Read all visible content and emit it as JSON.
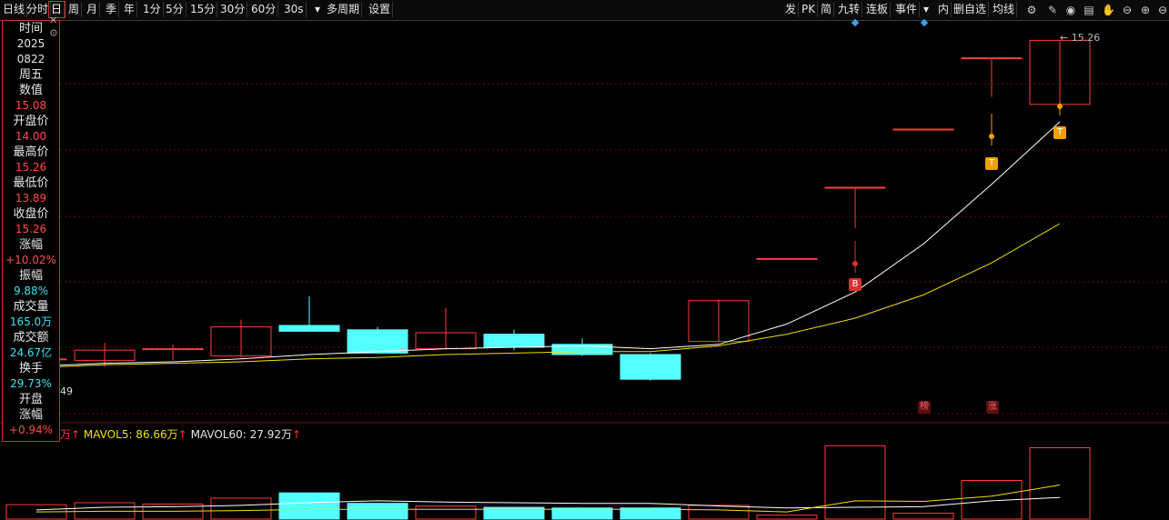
{
  "toolbar": {
    "left_items": [
      "日线",
      "分时",
      "日",
      "周",
      "月",
      "季",
      "年",
      "1分",
      "5分",
      "15分",
      "30分",
      "60分",
      "30s",
      "多周期",
      "设置"
    ],
    "right_items": [
      "发",
      "PK",
      "简",
      "九转",
      "连板",
      "事件",
      "内",
      "删自选",
      "均线"
    ],
    "dropdown_icon": "caret-down-icon"
  },
  "info": {
    "time_label": "时间",
    "year": "2025",
    "date": "0822",
    "weekday": "周五",
    "value_label": "数值",
    "value": "15.08",
    "open_label": "开盘价",
    "open": "14.00",
    "high_label": "最高价",
    "high": "15.26",
    "low_label": "最低价",
    "low": "13.89",
    "close_label": "收盘价",
    "close": "15.26",
    "change_label": "涨幅",
    "change": "+10.02%",
    "amplitude_label": "振幅",
    "amplitude": "9.88%",
    "volume_label": "成交量",
    "volume": "165.0万",
    "turnover_label": "成交额",
    "turnover": "24.67亿",
    "hand_label": "换手",
    "hand": "29.73%",
    "open_gap_label_1": "开盘",
    "open_gap_label_2": "涨幅",
    "open_gap": "+0.94%"
  },
  "price_marker": "15.26",
  "volume_legend": {
    "vol_tail": "万↑",
    "mavol5": "MAVOL5: 86.66万",
    "mavol5_arrow": "↑",
    "mavol60": "MAVOL60: 27.92万",
    "mavol60_arrow": "↑"
  },
  "low_label": "49",
  "flags": {
    "buy": "B",
    "t1": "T",
    "t2": "T",
    "bang": "榜",
    "zhang": "涨"
  },
  "colors": {
    "up": "#ff3b3b",
    "down": "#54ffff",
    "ma_white": "#ffffff",
    "ma_yellow": "#f0e000",
    "grid": "#5a1010",
    "flag_red": "#e03030",
    "flag_orange": "#f0a000"
  },
  "chart_data": {
    "type": "candlestick",
    "price_panel": {
      "candles": [
        {
          "o": 13.07,
          "h": 13.11,
          "l": 12.98,
          "c": 13.07
        },
        {
          "o": 13.06,
          "h": 13.18,
          "l": 13.02,
          "c": 13.13
        },
        {
          "o": 13.14,
          "h": 13.17,
          "l": 13.06,
          "c": 13.14
        },
        {
          "o": 13.09,
          "h": 13.34,
          "l": 13.09,
          "c": 13.29
        },
        {
          "o": 13.3,
          "h": 13.5,
          "l": 13.27,
          "c": 13.26
        },
        {
          "o": 13.27,
          "h": 13.29,
          "l": 13.12,
          "c": 13.11
        },
        {
          "o": 13.14,
          "h": 13.42,
          "l": 13.14,
          "c": 13.25
        },
        {
          "o": 13.24,
          "h": 13.27,
          "l": 13.13,
          "c": 13.15
        },
        {
          "o": 13.17,
          "h": 13.21,
          "l": 13.09,
          "c": 13.1
        },
        {
          "o": 13.1,
          "h": 13.11,
          "l": 12.92,
          "c": 12.93
        },
        {
          "o": 13.19,
          "h": 13.48,
          "l": 13.19,
          "c": 13.47
        },
        {
          "o": 13.76,
          "h": 13.76,
          "l": 13.76,
          "c": 13.76
        },
        {
          "o": 14.25,
          "h": 14.25,
          "l": 13.97,
          "c": 14.25
        },
        {
          "o": 14.65,
          "h": 14.65,
          "l": 14.65,
          "c": 14.65
        },
        {
          "o": 15.14,
          "h": 15.14,
          "l": 14.87,
          "c": 15.14
        },
        {
          "o": 14.82,
          "h": 15.26,
          "l": 14.82,
          "c": 15.26
        }
      ],
      "ma_white": [
        13.02,
        13.04,
        13.05,
        13.07,
        13.1,
        13.12,
        13.14,
        13.15,
        13.16,
        13.14,
        13.17,
        13.31,
        13.53,
        13.86,
        14.27,
        14.7
      ],
      "ma_yellow": [
        13.01,
        13.03,
        13.04,
        13.05,
        13.07,
        13.08,
        13.1,
        13.11,
        13.12,
        13.12,
        13.16,
        13.24,
        13.35,
        13.51,
        13.73,
        14.0
      ],
      "y_range": [
        12.85,
        15.35
      ]
    },
    "volume_panel": {
      "volumes": [
        22,
        25,
        23,
        32,
        40,
        24,
        20,
        18,
        17,
        17,
        21,
        6,
        112,
        9,
        59,
        109
      ],
      "colors": [
        "up",
        "up",
        "up",
        "up",
        "down",
        "down",
        "up",
        "down",
        "down",
        "down",
        "up",
        "up",
        "up",
        "up",
        "up",
        "up"
      ],
      "mavol_white": [
        14,
        18,
        19,
        21,
        25,
        28,
        26,
        25,
        24,
        24,
        20,
        17,
        18,
        19,
        28,
        33
      ],
      "mavol_yellow": [
        11,
        12,
        12,
        13,
        15,
        15,
        15,
        15,
        15,
        15,
        14,
        11,
        28,
        27,
        35,
        52
      ],
      "y_range": [
        0,
        118
      ]
    }
  }
}
